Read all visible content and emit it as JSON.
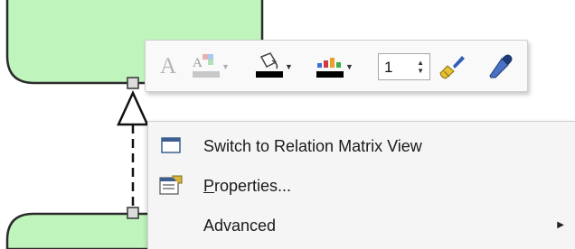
{
  "toolbar": {
    "font_icon": "A",
    "line_width": "1",
    "icons": [
      "font-color-icon",
      "fill-color-icon",
      "line-color-icon",
      "background-color-icon",
      "format-painter-icon",
      "color-picker-icon"
    ]
  },
  "menu": {
    "items": [
      {
        "label": "Switch to Relation Matrix View",
        "icon": "matrix-view-icon"
      },
      {
        "label_underlined": "P",
        "label_rest": "roperties...",
        "icon": "properties-icon"
      },
      {
        "label": "Advanced",
        "has_submenu": true
      }
    ]
  },
  "colors": {
    "node_fill": "#bff5bd",
    "node_border": "#2b2b2b",
    "menu_bg": "#f5f5f5",
    "toolbar_bg": "#f9f9f9"
  }
}
